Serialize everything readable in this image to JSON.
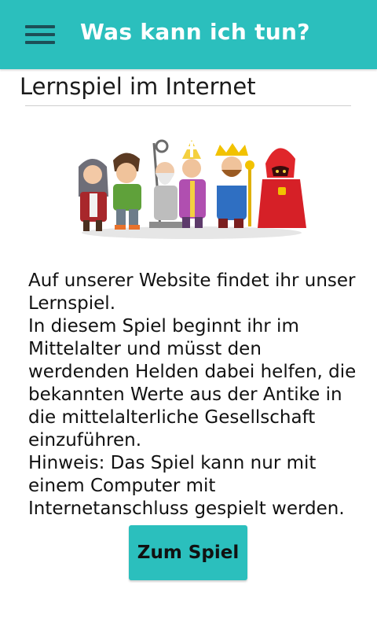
{
  "appbar": {
    "title": "Was kann ich tun?",
    "menu_icon": "hamburger-menu-icon",
    "color": "#2bbfbd"
  },
  "content": {
    "title": "Lernspiel im Internet",
    "illustration": "cartoon-characters-group",
    "paragraphs": [
      "Auf unserer Website findet ihr unser Lernspiel.",
      "In diesem Spiel beginnt ihr im Mittelalter und müsst den werdenden Helden dabei helfen, die bekannten Werte aus der Antike in die mittelalterliche Gesellschaft einzuführen.",
      "Hinweis: Das Spiel kann nur mit einem Computer mit Internetanschluss gespielt werden."
    ],
    "button_label": "Zum Spiel"
  }
}
